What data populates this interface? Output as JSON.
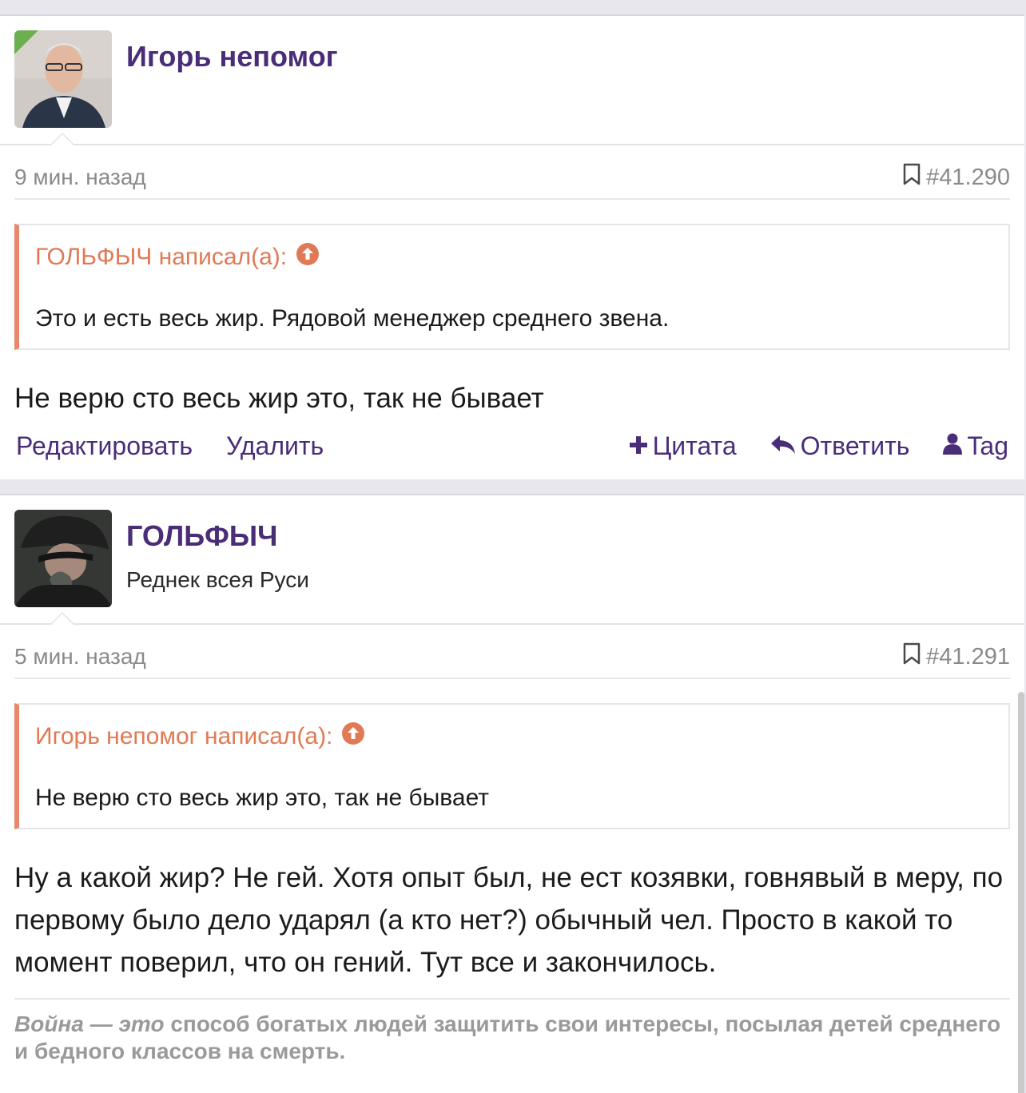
{
  "posts": [
    {
      "author": "Игорь непомог",
      "user_title": "",
      "time": "9 мин. назад",
      "post_number": "#41.290",
      "quote": {
        "author_line": "ГОЛЬФЫЧ написал(а):",
        "text": "Это и есть весь жир. Рядовой менеджер среднего звена."
      },
      "message": "Не верю сто весь жир это, так не бывает",
      "actions": {
        "edit": "Редактировать",
        "delete": "Удалить",
        "quote": "Цитата",
        "reply": "Ответить",
        "tag": "Tag"
      }
    },
    {
      "author": "ГОЛЬФЫЧ",
      "user_title": "Реднек всея Руси",
      "time": "5 мин. назад",
      "post_number": "#41.291",
      "quote": {
        "author_line": "Игорь непомог написал(а):",
        "text": "Не верю сто весь жир это, так не бывает"
      },
      "message": "Ну а какой жир? Не гей. Хотя опыт был, не ест козявки, говнявый в меру, по первому было дело ударял (а кто нет?) обычный чел. Просто в какой то момент поверил, что он гений. Тут все и закончилось.",
      "signature": {
        "lead": "Война — это",
        "rest": "способ богатых людей защитить свои интересы, посылая детей среднего и бедного классов на смерть."
      }
    }
  ],
  "icons": {
    "bookmark": "bookmark-icon",
    "quote_jump": "arrow-up-circle-icon",
    "plus": "plus-icon",
    "reply": "reply-icon",
    "user": "user-icon"
  },
  "colors": {
    "username": "#4a2d78",
    "quote_accent": "#e9876a",
    "link": "#4a2d78",
    "muted": "#8a8a8a"
  }
}
